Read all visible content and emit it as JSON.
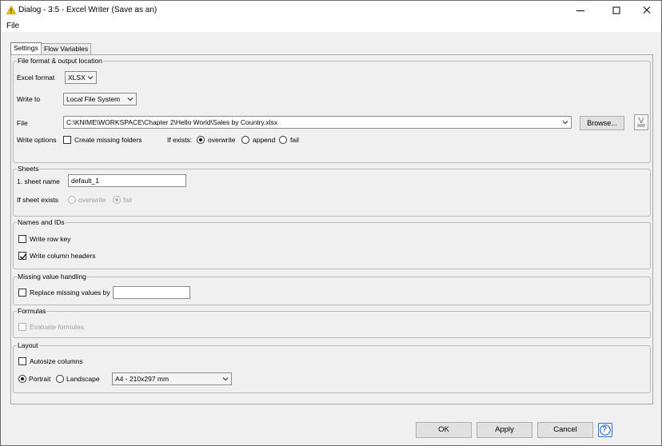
{
  "window": {
    "title": "Dialog - 3:5 - Excel Writer (Save as an)",
    "menu": {
      "file": "File"
    }
  },
  "tabs": [
    {
      "label": "Settings",
      "active": true
    },
    {
      "label": "Flow Variables",
      "active": false
    }
  ],
  "file_format": {
    "legend": "File format & output location",
    "excel_format_label": "Excel format",
    "excel_format_value": "XLSX",
    "write_to_label": "Write to",
    "write_to_value": "Local File System",
    "file_label": "File",
    "file_path": "C:\\KNIME\\WORKSPACE\\Chapter 2\\Hello World\\Sales by Country.xlsx",
    "browse_label": "Browse...",
    "write_options_label": "Write options",
    "create_missing_folders_label": "Create missing folders",
    "create_missing_folders_checked": false,
    "if_exists_label": "If exists:",
    "if_exists_options": [
      "overwrite",
      "append",
      "fail"
    ],
    "if_exists_selected": "overwrite"
  },
  "sheets": {
    "legend": "Sheets",
    "sheet_name_label": "1. sheet name",
    "sheet_name_value": "default_1",
    "if_sheet_exists_label": "If sheet exists",
    "if_sheet_exists_options": [
      "overwrite",
      "fail"
    ],
    "if_sheet_exists_selected": "fail"
  },
  "names_ids": {
    "legend": "Names and IDs",
    "write_row_key_label": "Write row key",
    "write_row_key_checked": false,
    "write_column_headers_label": "Write column headers",
    "write_column_headers_checked": true
  },
  "missing_values": {
    "legend": "Missing value handling",
    "replace_label": "Replace missing values by",
    "replace_checked": false,
    "replace_value": ""
  },
  "formulas": {
    "legend": "Formulas",
    "evaluate_label": "Evaluate formulas",
    "evaluate_checked": false
  },
  "layout": {
    "legend": "Layout",
    "autosize_label": "Autosize columns",
    "autosize_checked": false,
    "orientation_options": [
      "Portrait",
      "Landscape"
    ],
    "orientation_selected": "Portrait",
    "paper_size": "A4 - 210x297 mm"
  },
  "footer": {
    "ok": "OK",
    "apply": "Apply",
    "cancel": "Cancel",
    "help": "?"
  },
  "colors": {
    "warning_icon": "#f2c200",
    "help_accent": "#2f6fc4",
    "dialog_bg": "#f0f0f0"
  },
  "icons": {
    "title": "warning-triangle-icon",
    "minimize": "minimize-icon",
    "maximize": "maximize-icon",
    "close": "close-icon",
    "file_chooser_extra": "file-status-icon",
    "help": "help-icon"
  }
}
